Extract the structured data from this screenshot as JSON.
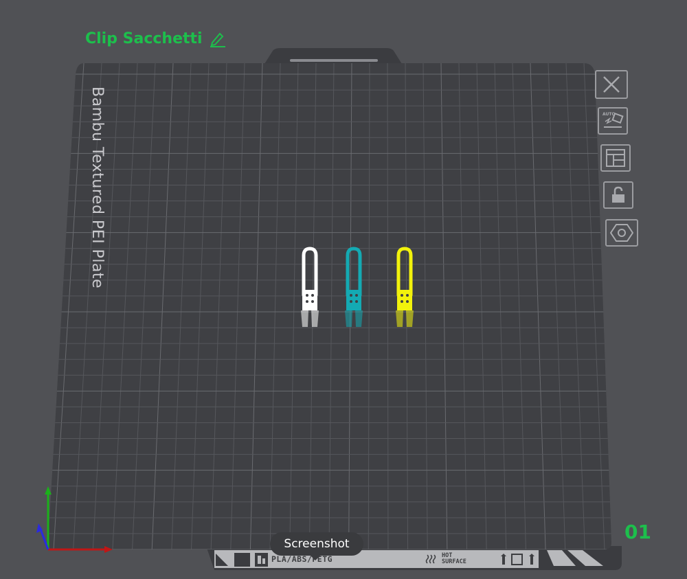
{
  "plate": {
    "name": "Clip Sacchetti",
    "bed_label": "Bambu Textured PEI Plate",
    "index": "01"
  },
  "tooltip": {
    "text": "Screenshot"
  },
  "bed_strip": {
    "filament_text": "PLA/ABS/PETG",
    "hot_line1": "HOT",
    "hot_line2": "SURFACE"
  },
  "toolbar": {
    "items": [
      {
        "name": "close-icon"
      },
      {
        "name": "auto-orient-icon",
        "badge": "AUTO"
      },
      {
        "name": "arrange-icon"
      },
      {
        "name": "lock-icon"
      },
      {
        "name": "plate-settings-icon"
      }
    ]
  },
  "objects": [
    {
      "name": "clip-white",
      "color": "#ffffff"
    },
    {
      "name": "clip-teal",
      "color": "#14aab3"
    },
    {
      "name": "clip-yellow",
      "color": "#f2f20c"
    }
  ],
  "colors": {
    "accent": "#1dbf4c",
    "background": "#505155",
    "bed": "#3f4044",
    "grid": "#5a5b60"
  }
}
